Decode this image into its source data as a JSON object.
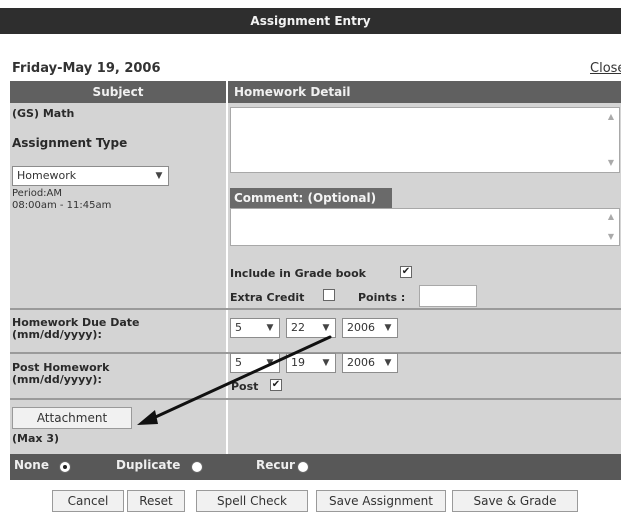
{
  "window": {
    "title": "Assignment Entry"
  },
  "header": {
    "date": "Friday-May 19, 2006",
    "close_label": "Close"
  },
  "columns": {
    "subject": "Subject",
    "homework_detail": "Homework Detail"
  },
  "left": {
    "subject_value": "(GS) Math",
    "assignment_type_label": "Assignment Type",
    "assignment_type_value": "Homework",
    "period": "Period:AM",
    "time": "08:00am - 11:45am",
    "due_date_label_1": "Homework Due Date",
    "due_date_label_2": "(mm/dd/yyyy):",
    "post_label_1": "Post Homework",
    "post_label_2": "(mm/dd/yyyy):",
    "attachment_label": "Attachment",
    "attachment_max": "(Max 3)"
  },
  "right": {
    "homework_detail_value": "",
    "comment_label": "Comment: (Optional)",
    "comment_value": "",
    "include_gradebook_label": "Include in Grade book",
    "include_gradebook_checked": "✔",
    "extra_credit_label": "Extra Credit",
    "points_label": "Points :",
    "points_value": "",
    "due_month": "5",
    "due_day": "22",
    "due_year": "2006",
    "post_month": "5",
    "post_day": "19",
    "post_year": "2006",
    "post_label": "Post",
    "post_checked": "✔"
  },
  "repeat": {
    "none": "None",
    "duplicate": "Duplicate",
    "recur": "Recur"
  },
  "actions": {
    "cancel": "Cancel",
    "reset": "Reset",
    "spell_check": "Spell Check",
    "save_assignment": "Save Assignment",
    "save_grade": "Save & Grade"
  },
  "icons": {
    "dropdown": "chevron-down-icon",
    "scroll_up": "scroll-up-icon",
    "scroll_down": "scroll-down-icon",
    "annotation_arrow": "arrow-icon"
  },
  "colors": {
    "title_bar": "#2e2e2e",
    "header_row": "#606060",
    "panel": "#d4d4d4",
    "bottom_bar": "#585858"
  }
}
